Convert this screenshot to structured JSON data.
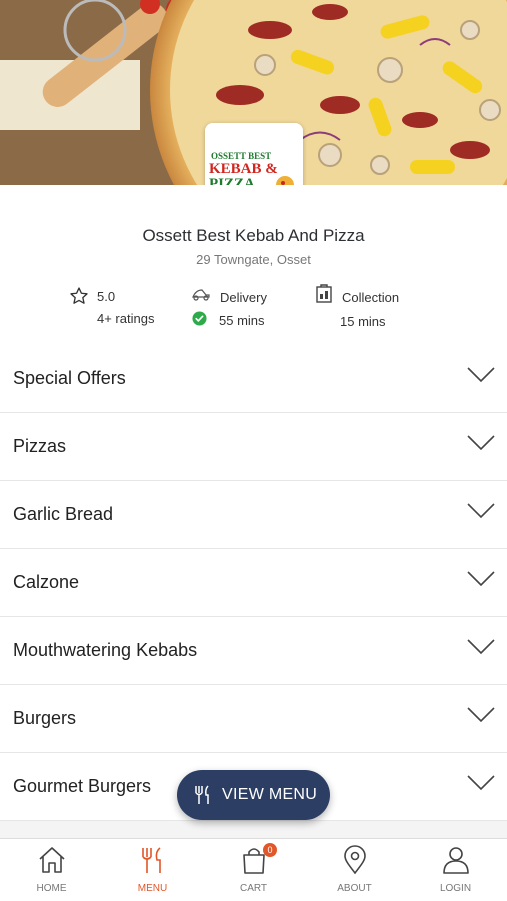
{
  "restaurant": {
    "name": "Ossett Best Kebab And Pizza",
    "address": "29 Towngate, Osset",
    "logo_text": [
      "OSSETT BEST",
      "KEBAB &",
      "PIZZA"
    ]
  },
  "stats": {
    "rating": "5.0",
    "ratings_count": "4+ ratings",
    "delivery_label": "Delivery",
    "delivery_time": "55 mins",
    "collection_label": "Collection",
    "collection_time": "15 mins"
  },
  "menu_categories": [
    {
      "label": "Special Offers"
    },
    {
      "label": "Pizzas"
    },
    {
      "label": "Garlic Bread"
    },
    {
      "label": "Calzone"
    },
    {
      "label": "Mouthwatering Kebabs"
    },
    {
      "label": "Burgers"
    },
    {
      "label": "Gourmet Burgers"
    }
  ],
  "view_menu_label": "VIEW MENU",
  "tabs": {
    "home": "HOME",
    "menu": "MENU",
    "cart": "CART",
    "cart_count": "0",
    "about": "ABOUT",
    "login": "LOGIN"
  },
  "colors": {
    "accent": "#e2572a",
    "button": "#2c3e63",
    "check": "#2eaa4a"
  },
  "icons": {
    "rating": "star-icon",
    "delivery": "delivery-scooter-icon",
    "delivery_status": "check-circle-icon",
    "collection": "collection-bag-icon",
    "chevron": "chevron-down-icon",
    "view_menu": "utensils-icon",
    "home": "home-icon",
    "menu": "utensils-icon",
    "cart": "shopping-bag-icon",
    "about": "map-pin-icon",
    "login": "user-icon"
  }
}
